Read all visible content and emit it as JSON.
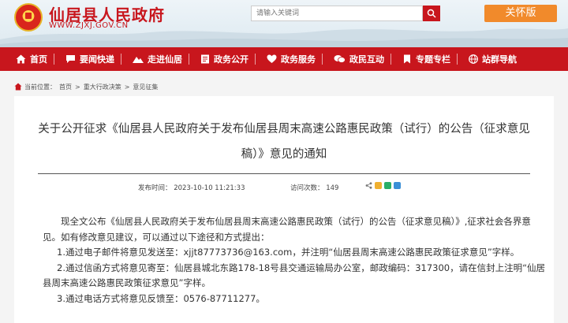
{
  "header": {
    "site_title": "仙居县人民政府",
    "site_url": "WWW.ZJXJ.GOV.CN",
    "search_placeholder": "请输入关键词",
    "care_button": "关怀版"
  },
  "nav": [
    {
      "label": "首页",
      "icon": "home-icon"
    },
    {
      "label": "要闻快递",
      "icon": "chat-icon"
    },
    {
      "label": "走进仙居",
      "icon": "mountain-icon"
    },
    {
      "label": "政务公开",
      "icon": "document-icon"
    },
    {
      "label": "政务服务",
      "icon": "heart-icon"
    },
    {
      "label": "政民互动",
      "icon": "speech-icon"
    },
    {
      "label": "专题专栏",
      "icon": "bookmark-icon"
    },
    {
      "label": "站群导航",
      "icon": "globe-icon"
    }
  ],
  "breadcrumb": {
    "label": "当前位置：",
    "items": [
      "首页",
      "重大行政决策",
      "意见征集"
    ]
  },
  "article": {
    "title": "关于公开征求《仙居县人民政府关于发布仙居县周末高速公路惠民政策（试行）的公告（征求意见稿）》意见的通知",
    "publish_time": "发布时间：  2023-10-10 11:21:33",
    "visits": "访问次数：  149",
    "paragraphs": [
      "现全文公布《仙居县人民政府关于发布仙居县周末高速公路惠民政策（试行）的公告（征求意见稿）》,征求社会各界意见。如有修改意见建议，可以通过以下途径和方式提出：",
      "1.通过电子邮件将意见发送至：xjjt87773736@163.com，并注明“仙居县周末高速公路惠民政策征求意见”字样。",
      "2.通过信函方式将意见寄至：仙居县城北东路178-18号县交通运输局办公室，邮政编码：317300，请在信封上注明“仙居县周末高速公路惠民政策征求意见”字样。",
      "3.通过电话方式将意见反馈至：0576-87711277。"
    ]
  },
  "colors": {
    "brand_red": "#c8161d",
    "care_orange": "#f18a2b"
  }
}
